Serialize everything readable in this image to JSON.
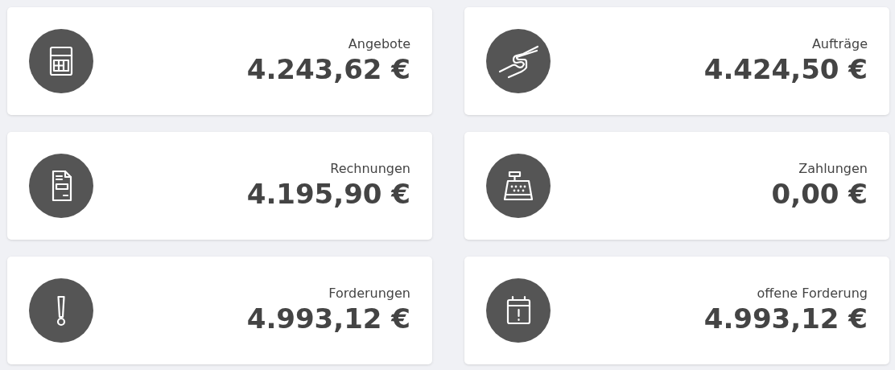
{
  "cards": [
    {
      "kind": "calculator",
      "label": "Angebote",
      "value": "4.243,62 €"
    },
    {
      "kind": "handshake",
      "label": "Aufträge",
      "value": "4.424,50 €"
    },
    {
      "kind": "document",
      "label": "Rechnungen",
      "value": "4.195,90 €"
    },
    {
      "kind": "register",
      "label": "Zahlungen",
      "value": "0,00 €"
    },
    {
      "kind": "exclamation",
      "label": "Forderungen",
      "value": "4.993,12 €"
    },
    {
      "kind": "calendar",
      "label": "offene Forderung",
      "value": "4.993,12 €"
    }
  ]
}
